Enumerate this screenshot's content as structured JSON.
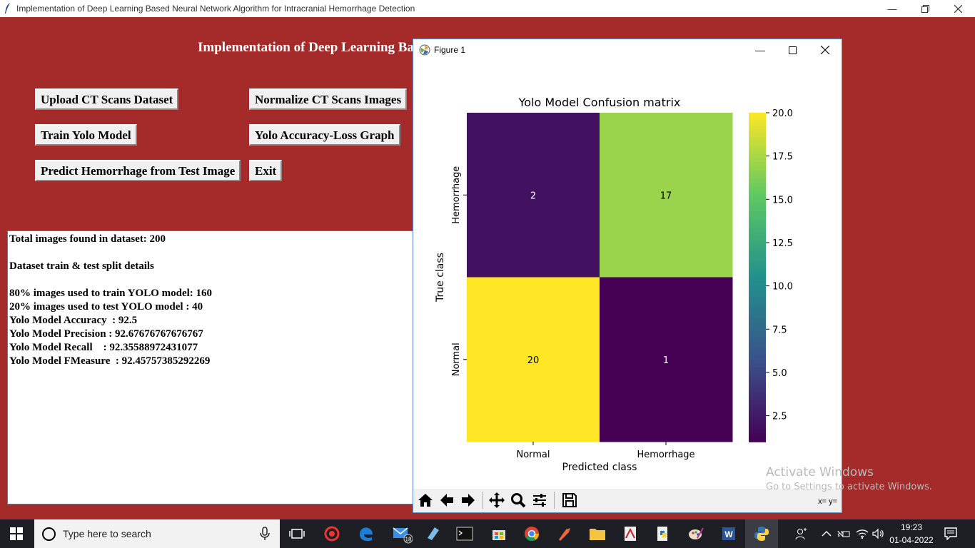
{
  "app": {
    "title": "Implementation of Deep Learning Based Neural Network Algorithm for Intracranial Hemorrhage Detection",
    "heading": "Implementation of Deep Learning Based Neural Network Algorithm for Intracranial Hemorrhage Detection"
  },
  "buttons": {
    "upload": "Upload CT Scans Dataset",
    "normalize": "Normalize CT Scans Images",
    "train": "Train Yolo Model",
    "graph": "Yolo Accuracy-Loss Graph",
    "predict": "Predict Hemorrhage from Test Image",
    "exit": "Exit"
  },
  "output_lines": [
    "Total images found in dataset: 200",
    "",
    "Dataset train & test split details",
    "",
    "80% images used to train YOLO model: 160",
    "20% images used to test YOLO model : 40",
    "Yolo Model Accuracy  : 92.5",
    "Yolo Model Precision : 92.67676767676767",
    "Yolo Model Recall    : 92.35588972431077",
    "Yolo Model FMeasure  : 92.45757385292269"
  ],
  "figure": {
    "title": "Figure 1",
    "coords": "x= y=",
    "toolbar_icons": [
      "home-icon",
      "back-icon",
      "forward-icon",
      "pan-icon",
      "zoom-icon",
      "configure-icon",
      "save-icon"
    ]
  },
  "chart_data": {
    "type": "heatmap",
    "title": "Yolo Model Confusion matrix",
    "xlabel": "Predicted class",
    "ylabel": "True class",
    "x_categories": [
      "Normal",
      "Hemorrhage"
    ],
    "y_categories": [
      "Hemorrhage",
      "Normal"
    ],
    "values": [
      [
        2,
        17
      ],
      [
        20,
        1
      ]
    ],
    "colormap": "viridis",
    "colorbar": {
      "min": 1,
      "max": 20,
      "ticks": [
        2.5,
        5.0,
        7.5,
        10.0,
        12.5,
        15.0,
        17.5,
        20.0
      ]
    }
  },
  "watermark": {
    "line1": "Activate Windows",
    "line2": "Go to Settings to activate Windows."
  },
  "taskbar": {
    "search_placeholder": "Type here to search",
    "mail_badge": "18",
    "time": "19:23",
    "date": "01-04-2022"
  }
}
